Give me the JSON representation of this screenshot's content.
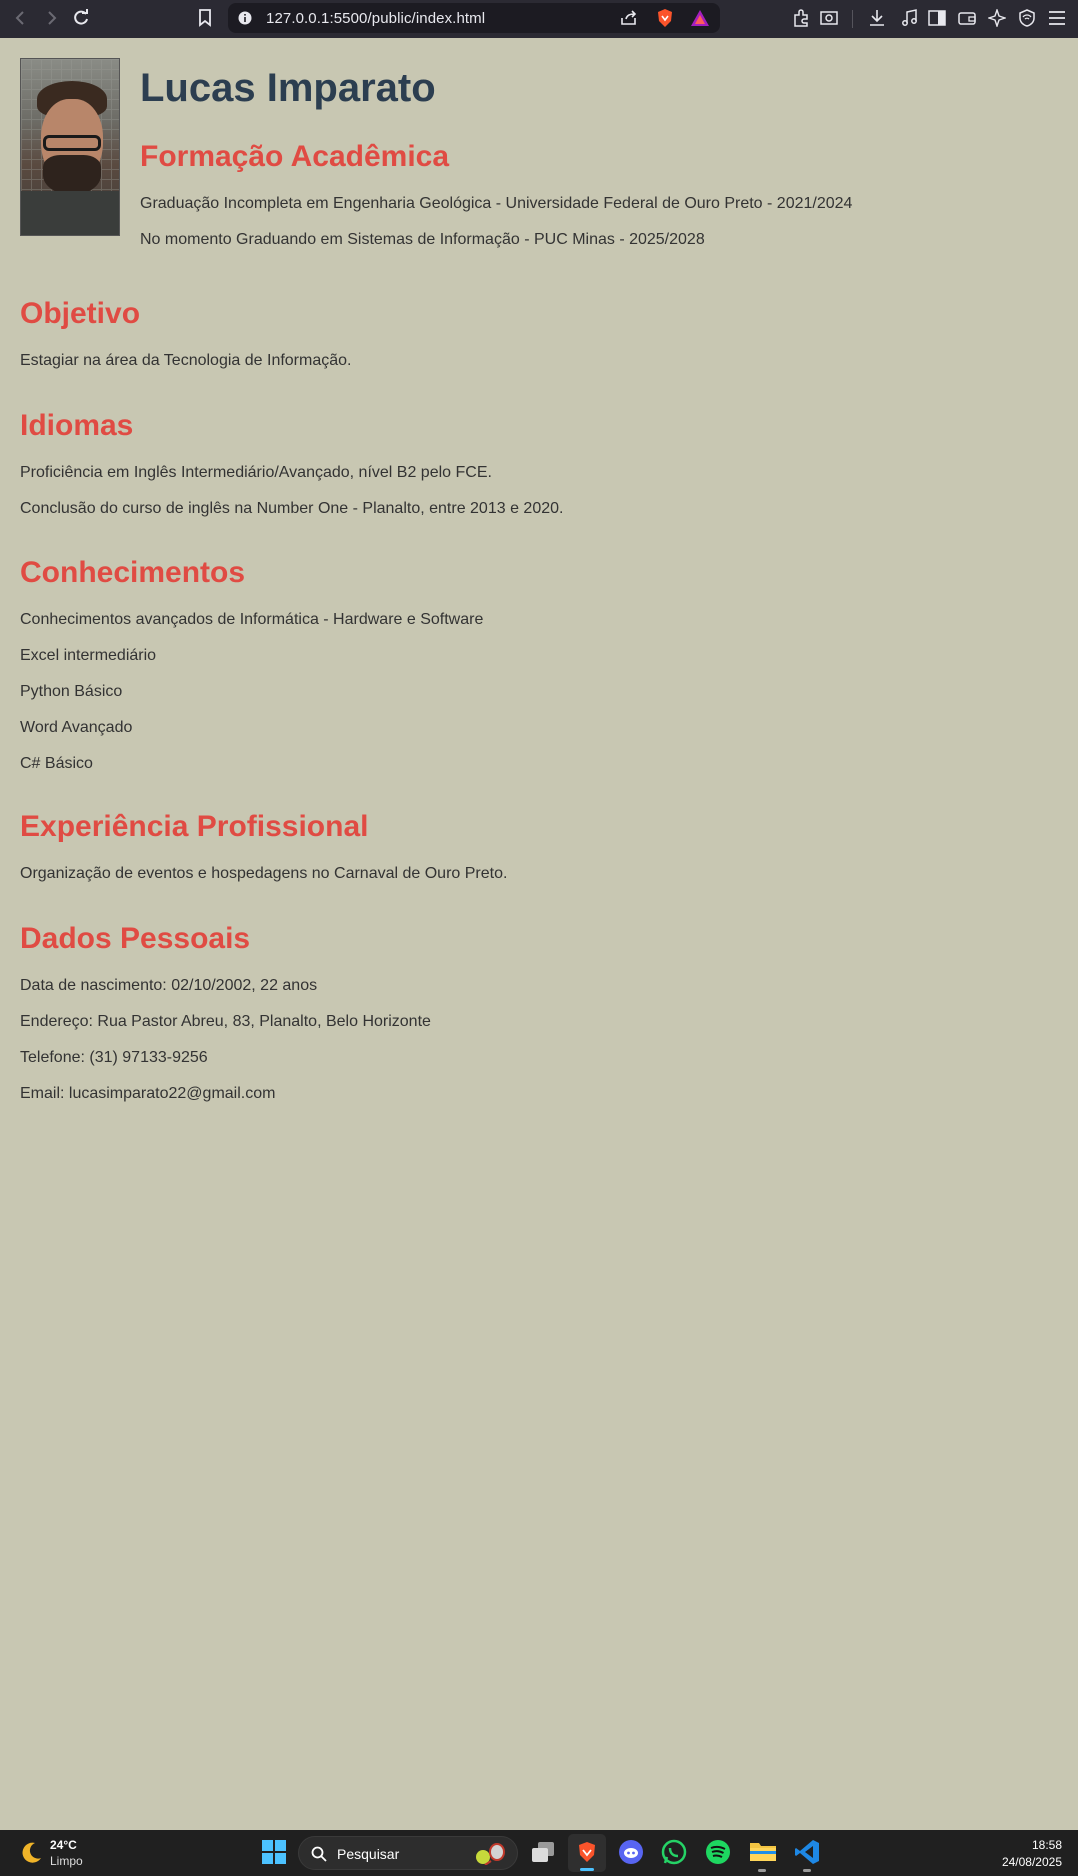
{
  "browser": {
    "url": "127.0.0.1:5500/public/index.html"
  },
  "profile": {
    "name": "Lucas Imparato"
  },
  "sections": {
    "formacao": {
      "title": "Formação Acadêmica",
      "items": [
        "Graduação Incompleta em Engenharia Geológica - Universidade Federal de Ouro Preto - 2021/2024",
        "No momento Graduando em Sistemas de Informação - PUC Minas - 2025/2028"
      ]
    },
    "objetivo": {
      "title": "Objetivo",
      "items": [
        "Estagiar na área da Tecnologia de Informação."
      ]
    },
    "idiomas": {
      "title": "Idiomas",
      "items": [
        "Proficiência em Inglês Intermediário/Avançado, nível B2 pelo FCE.",
        "Conclusão do curso de inglês na Number One - Planalto, entre 2013 e 2020."
      ]
    },
    "conhecimentos": {
      "title": "Conhecimentos",
      "items": [
        "Conhecimentos avançados de Informática - Hardware e Software",
        "Excel intermediário",
        "Python Básico",
        "Word Avançado",
        "C# Básico"
      ]
    },
    "experiencia": {
      "title": "Experiência Profissional",
      "items": [
        "Organização de eventos e hospedagens no Carnaval de Ouro Preto."
      ]
    },
    "dados": {
      "title": "Dados Pessoais",
      "items": [
        "Data de nascimento: 02/10/2002, 22 anos",
        "Endereço: Rua Pastor Abreu, 83, Planalto, Belo Horizonte",
        "Telefone: (31) 97133-9256",
        "Email: lucasimparato22@gmail.com"
      ]
    }
  },
  "taskbar": {
    "weather_temp": "24°C",
    "weather_desc": "Limpo",
    "search_placeholder": "Pesquisar",
    "time": "18:58",
    "date": "24/08/2025"
  },
  "colors": {
    "page_bg": "#c8c7b2",
    "heading_red": "#e04b43",
    "name_navy": "#2c3e50",
    "chrome_bg": "#2b2a33",
    "taskbar_bg": "#202020"
  },
  "icons": [
    "back-icon",
    "forward-icon",
    "reload-icon",
    "bookmark-icon",
    "info-icon",
    "share-icon",
    "brave-shield-icon",
    "brave-rewards-icon",
    "extensions-icon",
    "screenshot-icon",
    "download-icon",
    "music-icon",
    "sidebar-icon",
    "wallet-icon",
    "leo-ai-icon",
    "vpn-icon",
    "menu-icon",
    "weather-moon-icon",
    "windows-start-icon",
    "search-icon",
    "task-view-icon",
    "brave-app-icon",
    "discord-app-icon",
    "whatsapp-app-icon",
    "spotify-app-icon",
    "file-explorer-icon",
    "vscode-app-icon"
  ]
}
